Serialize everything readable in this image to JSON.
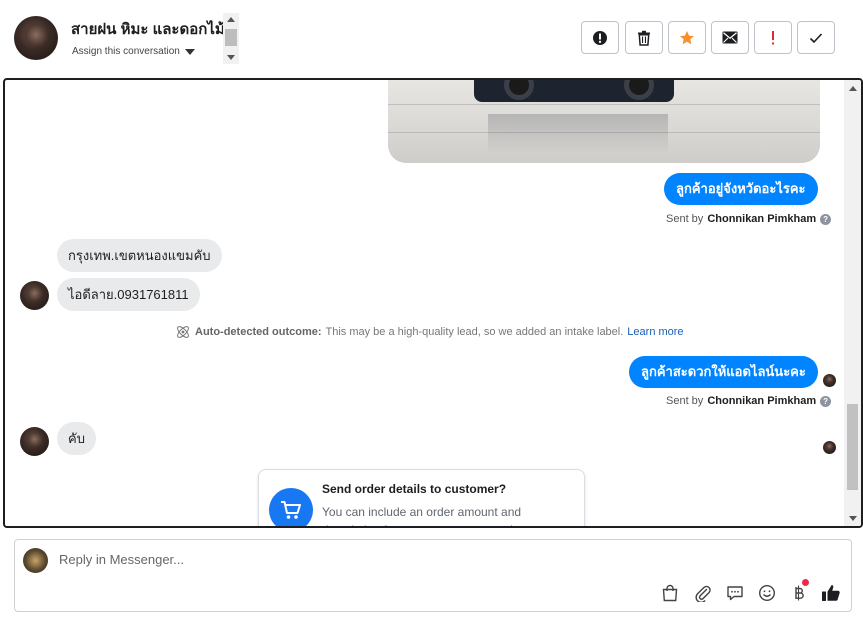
{
  "header": {
    "contact_name": "สายฝน หิมะ และดอกไม้",
    "assign_label": "Assign this conversation",
    "actions": [
      {
        "name": "spam-button",
        "icon": "alert-circle-icon"
      },
      {
        "name": "delete-button",
        "icon": "trash-icon"
      },
      {
        "name": "star-button",
        "icon": "star-icon"
      },
      {
        "name": "mark-unread-button",
        "icon": "envelope-icon"
      },
      {
        "name": "follow-up-button",
        "icon": "exclamation-icon"
      },
      {
        "name": "mark-done-button",
        "icon": "check-icon"
      }
    ]
  },
  "messages": {
    "out_1": "ลูกค้าอยู่จังหวัดอะไรคะ",
    "sent_by_prefix": "Sent by",
    "sent_by_name": "Chonnikan Pimkham",
    "in_1": "กรุงเทพ.เขตหนองแขมคับ",
    "in_2": "ไอดีลาย.0931761811",
    "out_2": "ลูกค้าสะดวกให้แอดไลน์นะคะ",
    "in_3": "คับ"
  },
  "auto_detected": {
    "label": "Auto-detected outcome:",
    "text": "This may be a high-quality lead, so we added an intake label.",
    "link": "Learn more"
  },
  "order_card": {
    "title": "Send order details to customer?",
    "description": "You can include an order amount and description for your customer to review."
  },
  "reply": {
    "placeholder": "Reply in Messenger..."
  },
  "colors": {
    "accent": "#0084ff",
    "star": "#f5922f",
    "follow_up": "#e02c2c",
    "incoming_bubble": "#e9eaeb",
    "notification_dot": "#f02849"
  }
}
